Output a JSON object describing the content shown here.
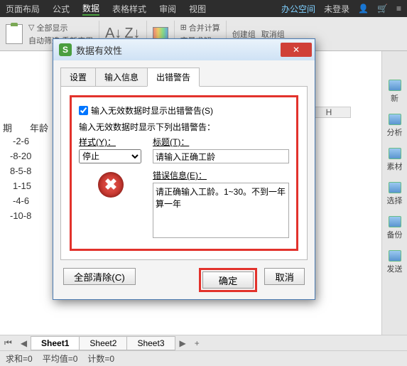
{
  "menu": {
    "items": [
      "页面布局",
      "公式",
      "数据",
      "表格样式",
      "审阅",
      "视图"
    ],
    "office": "办公空间",
    "login": "未登录"
  },
  "ribbon": {
    "showall": "全部显示",
    "autofilter": "自动筛选",
    "reapply": "重新应用",
    "merge_calc": "合并计算",
    "solver": "变量求解",
    "create_group": "创建组",
    "ungroup": "取消组"
  },
  "columns": [
    "H"
  ],
  "row_header": [
    "期",
    "年龄"
  ],
  "cells": [
    "-2-6",
    "-8-20",
    "8-5-8",
    "1-15",
    "-4-6",
    "-10-8"
  ],
  "sidebar": {
    "new": "新",
    "analysis": "分析",
    "material": "素材",
    "select": "选择",
    "backup": "备份",
    "send": "发送"
  },
  "dialog": {
    "title": "数据有效性",
    "tabs": [
      "设置",
      "输入信息",
      "出错警告"
    ],
    "chk_label": "输入无效数据时显示出错警告(S)",
    "group_label": "输入无效数据时显示下列出错警告：",
    "style_label": "样式(Y)：",
    "style_value": "停止",
    "title_label": "标题(T)：",
    "title_value": "请输入正确工龄",
    "msg_label": "错误信息(E)：",
    "msg_value": "请正确输入工龄。1~30。不到一年算一年",
    "clear": "全部清除(C)",
    "ok": "确定",
    "cancel": "取消"
  },
  "sheets": {
    "tabs": [
      "Sheet1",
      "Sheet2",
      "Sheet3"
    ],
    "add": "+"
  },
  "status": {
    "sum": "求和=0",
    "avg": "平均值=0",
    "count": "计数=0"
  }
}
